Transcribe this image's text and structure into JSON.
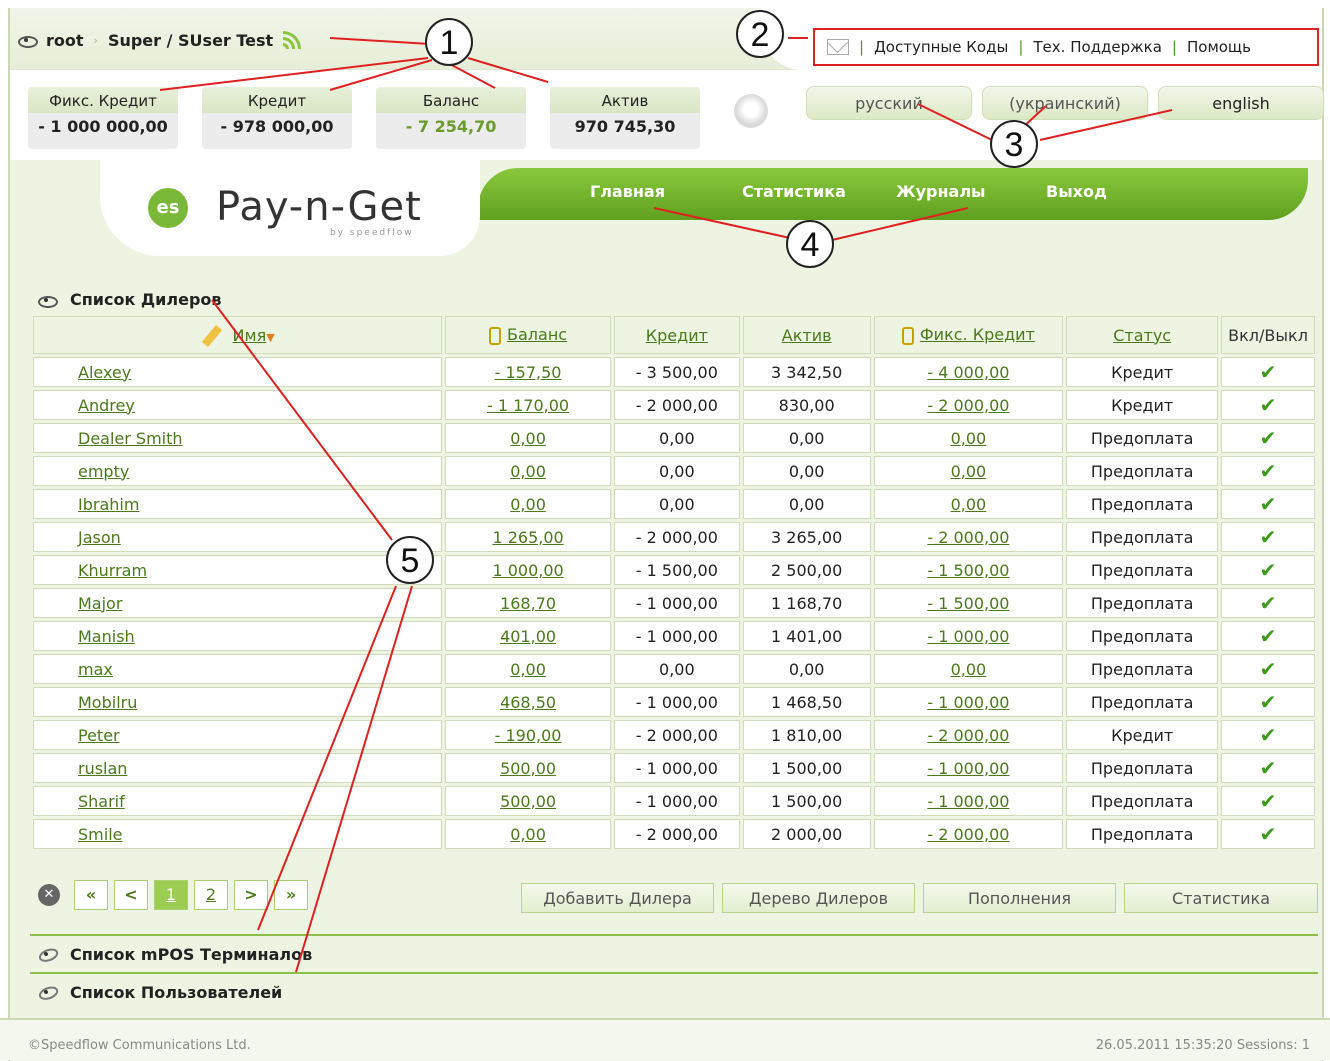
{
  "breadcrumb": {
    "root": "root",
    "path": "Super / SUser Test"
  },
  "top_links": [
    "Доступные Коды",
    "Тех. Поддержка",
    "Помощь"
  ],
  "stats": [
    {
      "label": "Фикс. Кредит",
      "value": "- 1 000 000,00"
    },
    {
      "label": "Кредит",
      "value": "- 978 000,00"
    },
    {
      "label": "Баланс",
      "value": "- 7 254,70"
    },
    {
      "label": "Актив",
      "value": "970 745,30"
    }
  ],
  "languages": [
    "русский",
    "(украинский)",
    "english"
  ],
  "nav": [
    "Главная",
    "Статистика",
    "Журналы",
    "Выход"
  ],
  "logo": {
    "mark": "es",
    "name": "Pay-n-Get",
    "by": "by speedflow"
  },
  "dealers": {
    "title": "Список Дилеров",
    "headers": [
      "Имя",
      "Баланс",
      "Кредит",
      "Актив",
      "Фикс. Кредит",
      "Статус",
      "Вкл/Выкл"
    ],
    "rows": [
      [
        "Alexey",
        "- 157,50",
        "- 3 500,00",
        "3 342,50",
        "- 4 000,00",
        "Кредит"
      ],
      [
        "Andrey",
        "- 1 170,00",
        "- 2 000,00",
        "830,00",
        "- 2 000,00",
        "Кредит"
      ],
      [
        "Dealer Smith",
        "0,00",
        "0,00",
        "0,00",
        "0,00",
        "Предоплата"
      ],
      [
        "empty",
        "0,00",
        "0,00",
        "0,00",
        "0,00",
        "Предоплата"
      ],
      [
        "Ibrahim",
        "0,00",
        "0,00",
        "0,00",
        "0,00",
        "Предоплата"
      ],
      [
        "Jason",
        "1 265,00",
        "- 2 000,00",
        "3 265,00",
        "- 2 000,00",
        "Предоплата"
      ],
      [
        "Khurram",
        "1 000,00",
        "- 1 500,00",
        "2 500,00",
        "- 1 500,00",
        "Предоплата"
      ],
      [
        "Major",
        "168,70",
        "- 1 000,00",
        "1 168,70",
        "- 1 500,00",
        "Предоплата"
      ],
      [
        "Manish",
        "401,00",
        "- 1 000,00",
        "1 401,00",
        "- 1 000,00",
        "Предоплата"
      ],
      [
        "max",
        "0,00",
        "0,00",
        "0,00",
        "0,00",
        "Предоплата"
      ],
      [
        "Mobilru",
        "468,50",
        "- 1 000,00",
        "1 468,50",
        "- 1 000,00",
        "Предоплата"
      ],
      [
        "Peter",
        "- 190,00",
        "- 2 000,00",
        "1 810,00",
        "- 2 000,00",
        "Кредит"
      ],
      [
        "ruslan",
        "500,00",
        "- 1 000,00",
        "1 500,00",
        "- 1 000,00",
        "Предоплата"
      ],
      [
        "Sharif",
        "500,00",
        "- 1 000,00",
        "1 500,00",
        "- 1 000,00",
        "Предоплата"
      ],
      [
        "Smile",
        "0,00",
        "- 2 000,00",
        "2 000,00",
        "- 2 000,00",
        "Предоплата"
      ]
    ]
  },
  "pager": {
    "first": "«",
    "prev": "<",
    "pages": [
      "1",
      "2"
    ],
    "next": ">",
    "last": "»"
  },
  "actions": [
    "Добавить Дилера",
    "Дерево Дилеров",
    "Пополнения",
    "Статистика"
  ],
  "sections": [
    "Список mPOS Терминалов",
    "Список Пользователей"
  ],
  "footer": {
    "copyright": "©Speedflow Communications Ltd.",
    "status": "26.05.2011 15:35:20 Sessions: 1"
  },
  "callouts": [
    "1",
    "2",
    "3",
    "4",
    "5"
  ],
  "colors": {
    "accent": "#7ab83a",
    "annotation": "#e02020"
  }
}
